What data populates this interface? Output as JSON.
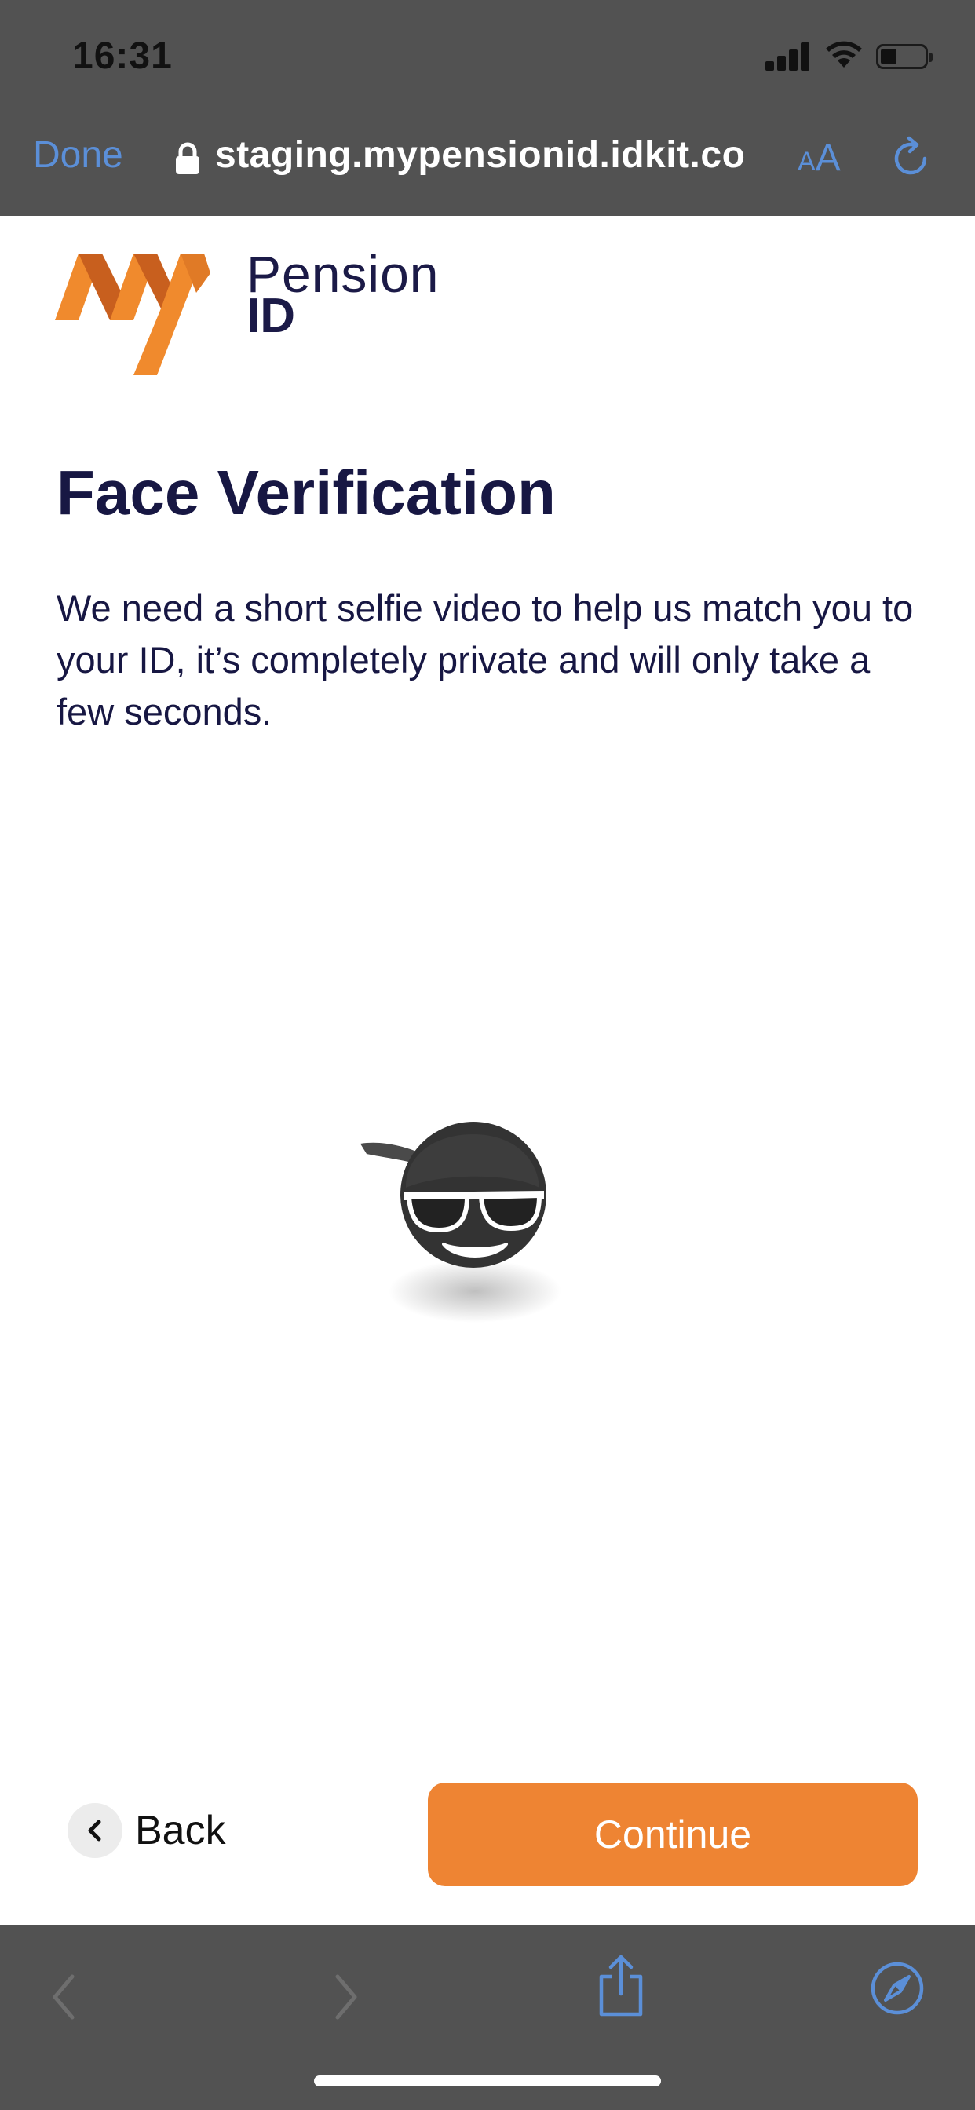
{
  "status_bar": {
    "time": "16:31"
  },
  "browser": {
    "done_label": "Done",
    "url": "staging.mypensionid.idkit.co",
    "text_size_small": "A",
    "text_size_large": "A",
    "accent_color": "#5b8fd8",
    "bar_color": "#525252"
  },
  "logo": {
    "word1": "Pension",
    "word2": "ID",
    "mark_color": "#f08a2d"
  },
  "page": {
    "title": "Face Verification",
    "description": "We need a short selfie video to help us match you to your ID, it’s completely private and will only take a few seconds."
  },
  "actions": {
    "back_label": "Back",
    "continue_label": "Continue",
    "continue_color": "#ee8433"
  },
  "icons": {
    "lock": "lock-icon",
    "reload": "reload-icon",
    "back": "chevron-left-icon",
    "forward": "chevron-right-icon",
    "share": "share-icon",
    "compass": "compass-icon",
    "avatar": "selfie-avatar-icon"
  }
}
